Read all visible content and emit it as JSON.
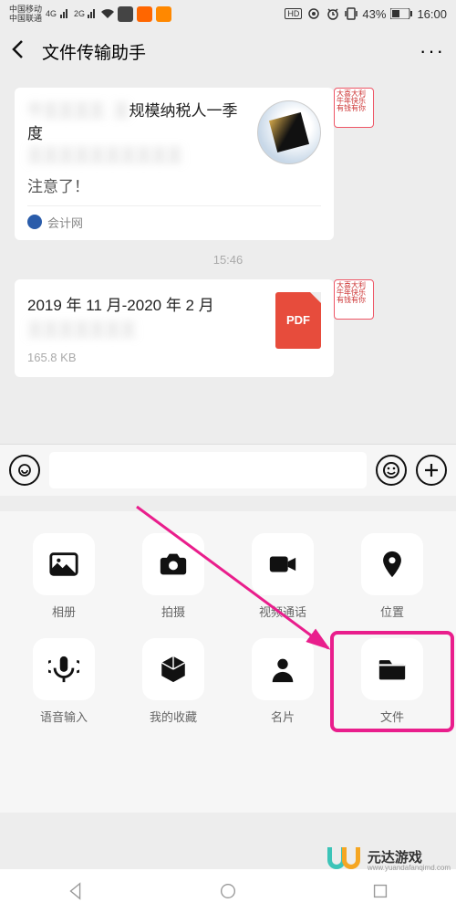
{
  "status": {
    "carrier1": "中国移动",
    "carrier2": "中国联通",
    "net": "4G",
    "net2": "2G",
    "hd": "HD",
    "battery": "43%",
    "time": "16:00"
  },
  "nav": {
    "title": "文件传输助手"
  },
  "msg1": {
    "title_suffix": "规模纳税人一季度",
    "sub": "注意了！",
    "source": "会计网"
  },
  "timestamp": "15:46",
  "msg2": {
    "title": "2019 年 11 月-2020 年 2 月",
    "size": "165.8 KB",
    "pdf": "PDF"
  },
  "panel": {
    "items": [
      {
        "label": "相册"
      },
      {
        "label": "拍摄"
      },
      {
        "label": "视频通话"
      },
      {
        "label": "位置"
      },
      {
        "label": "语音输入"
      },
      {
        "label": "我的收藏"
      },
      {
        "label": "名片"
      },
      {
        "label": "文件"
      }
    ]
  },
  "watermark": {
    "brand": "元达游戏",
    "url": "www.yuandafanqimd.com"
  }
}
